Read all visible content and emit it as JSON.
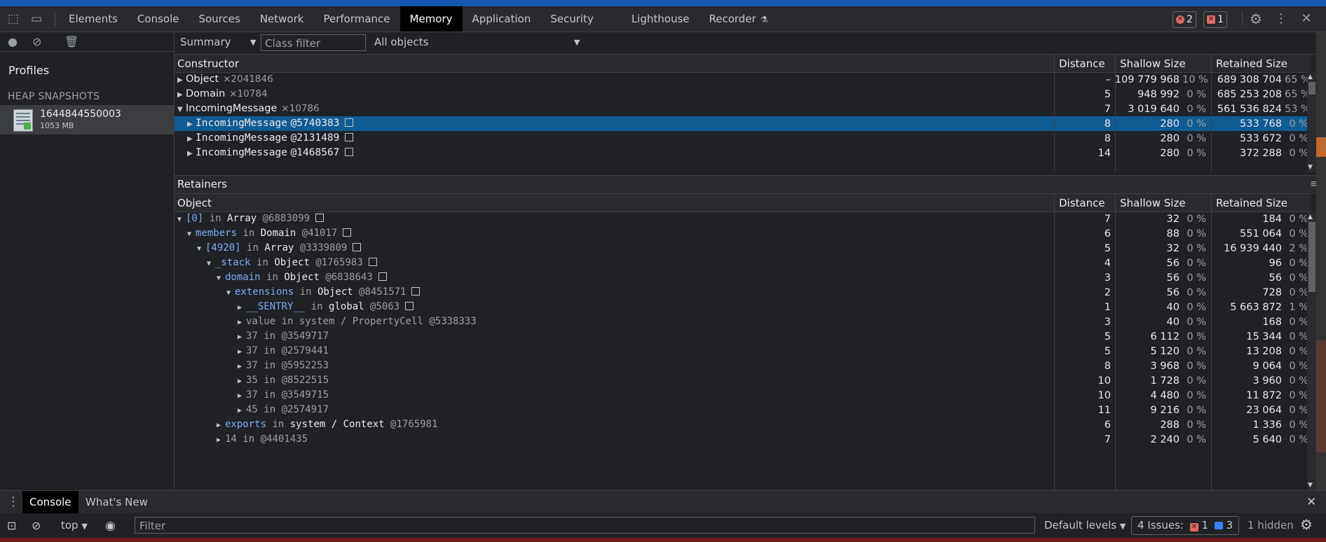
{
  "tabbar": {
    "tabs": [
      "Elements",
      "Console",
      "Sources",
      "Network",
      "Performance",
      "Memory",
      "Application",
      "Security",
      "Lighthouse",
      "Recorder"
    ],
    "active_tab": "Memory",
    "errors_count": "2",
    "warnings_count": "1"
  },
  "left": {
    "profiles_label": "Profiles",
    "heading": "HEAP SNAPSHOTS",
    "snapshot_name": "1644844550003",
    "snapshot_size": "1053 MB"
  },
  "toolbar": {
    "view_select": "Summary",
    "class_filter_placeholder": "Class filter",
    "objects_select": "All objects"
  },
  "constructors": {
    "columns": {
      "name": "Constructor",
      "distance": "Distance",
      "shallow": "Shallow Size",
      "retained": "Retained Size"
    },
    "rows": [
      {
        "tri": "▶",
        "name": "Object",
        "count": "×2041846",
        "distance": "–",
        "shallow": "109 779 968",
        "shallow_pct": "10 %",
        "retained": "689 308 704",
        "retained_pct": "65 %"
      },
      {
        "tri": "▶",
        "name": "Domain",
        "count": "×10784",
        "distance": "5",
        "shallow": "948 992",
        "shallow_pct": "0 %",
        "retained": "685 253 208",
        "retained_pct": "65 %"
      },
      {
        "tri": "▼",
        "name": "IncomingMessage",
        "count": "×10786",
        "distance": "7",
        "shallow": "3 019 640",
        "shallow_pct": "0 %",
        "retained": "561 536 824",
        "retained_pct": "53 %"
      },
      {
        "tri": "▶",
        "name": "IncomingMessage",
        "id": "@5740383",
        "distance": "8",
        "shallow": "280",
        "shallow_pct": "0 %",
        "retained": "533 768",
        "retained_pct": "0 %"
      },
      {
        "tri": "▶",
        "name": "IncomingMessage",
        "id": "@2131489",
        "distance": "8",
        "shallow": "280",
        "shallow_pct": "0 %",
        "retained": "533 672",
        "retained_pct": "0 %"
      },
      {
        "tri": "▶",
        "name": "IncomingMessage",
        "id": "@1468567",
        "distance": "14",
        "shallow": "280",
        "shallow_pct": "0 %",
        "retained": "372 288",
        "retained_pct": "0 %"
      }
    ]
  },
  "retainers": {
    "title": "Retainers",
    "columns": {
      "name": "Object",
      "distance": "Distance",
      "shallow": "Shallow Size",
      "retained": "Retained Size"
    },
    "rows": [
      {
        "tri": "▼",
        "prop": "[0]",
        "in": "in",
        "obj": "Array",
        "id": "@6883099",
        "distance": "7",
        "shallow": "32",
        "shallow_pct": "0 %",
        "retained": "184",
        "retained_pct": "0 %"
      },
      {
        "tri": "▼",
        "prop": "members",
        "in": "in",
        "obj": "Domain",
        "id": "@41017",
        "distance": "6",
        "shallow": "88",
        "shallow_pct": "0 %",
        "retained": "551 064",
        "retained_pct": "0 %"
      },
      {
        "tri": "▼",
        "prop": "[4920]",
        "in": "in",
        "obj": "Array",
        "id": "@3339809",
        "distance": "5",
        "shallow": "32",
        "shallow_pct": "0 %",
        "retained": "16 939 440",
        "retained_pct": "2 %"
      },
      {
        "tri": "▼",
        "prop": "_stack",
        "in": "in",
        "obj": "Object",
        "id": "@1765983",
        "distance": "4",
        "shallow": "56",
        "shallow_pct": "0 %",
        "retained": "96",
        "retained_pct": "0 %"
      },
      {
        "tri": "▼",
        "prop": "domain",
        "in": "in",
        "obj": "Object",
        "id": "@6838643",
        "distance": "3",
        "shallow": "56",
        "shallow_pct": "0 %",
        "retained": "56",
        "retained_pct": "0 %"
      },
      {
        "tri": "▼",
        "prop": "extensions",
        "in": "in",
        "obj": "Object",
        "id": "@8451571",
        "distance": "2",
        "shallow": "56",
        "shallow_pct": "0 %",
        "retained": "728",
        "retained_pct": "0 %"
      },
      {
        "tri": "▶",
        "prop": "__SENTRY__",
        "in": "in",
        "obj": "global",
        "id": "@5063",
        "distance": "1",
        "shallow": "40",
        "shallow_pct": "0 %",
        "retained": "5 663 872",
        "retained_pct": "1 %"
      },
      {
        "tri": "▶",
        "prop": "value",
        "in": "in",
        "obj": "system / PropertyCell",
        "id": "@5338333",
        "distance": "3",
        "shallow": "40",
        "shallow_pct": "0 %",
        "retained": "168",
        "retained_pct": "0 %"
      },
      {
        "tri": "▶",
        "prop": "37",
        "in": "in",
        "obj": "",
        "id": "@3549717",
        "distance": "5",
        "shallow": "6 112",
        "shallow_pct": "0 %",
        "retained": "15 344",
        "retained_pct": "0 %"
      },
      {
        "tri": "▶",
        "prop": "37",
        "in": "in",
        "obj": "",
        "id": "@2579441",
        "distance": "5",
        "shallow": "5 120",
        "shallow_pct": "0 %",
        "retained": "13 208",
        "retained_pct": "0 %"
      },
      {
        "tri": "▶",
        "prop": "37",
        "in": "in",
        "obj": "",
        "id": "@5952253",
        "distance": "8",
        "shallow": "3 968",
        "shallow_pct": "0 %",
        "retained": "9 064",
        "retained_pct": "0 %"
      },
      {
        "tri": "▶",
        "prop": "35",
        "in": "in",
        "obj": "",
        "id": "@8522515",
        "distance": "10",
        "shallow": "1 728",
        "shallow_pct": "0 %",
        "retained": "3 960",
        "retained_pct": "0 %"
      },
      {
        "tri": "▶",
        "prop": "37",
        "in": "in",
        "obj": "",
        "id": "@3549715",
        "distance": "10",
        "shallow": "4 480",
        "shallow_pct": "0 %",
        "retained": "11 872",
        "retained_pct": "0 %"
      },
      {
        "tri": "▶",
        "prop": "45",
        "in": "in",
        "obj": "",
        "id": "@2574917",
        "distance": "11",
        "shallow": "9 216",
        "shallow_pct": "0 %",
        "retained": "23 064",
        "retained_pct": "0 %"
      },
      {
        "tri": "▶",
        "prop": "exports",
        "in": "in",
        "obj": "system / Context",
        "id": "@1765981",
        "distance": "6",
        "shallow": "288",
        "shallow_pct": "0 %",
        "retained": "1 336",
        "retained_pct": "0 %"
      },
      {
        "tri": "▶",
        "prop": "14",
        "in": "in",
        "obj": "",
        "id": "@4401435",
        "distance": "7",
        "shallow": "2 240",
        "shallow_pct": "0 %",
        "retained": "5 640",
        "retained_pct": "0 %"
      }
    ]
  },
  "drawer": {
    "tabs": [
      "Console",
      "What's New"
    ],
    "context": "top",
    "filter_placeholder": "Filter",
    "levels": "Default levels",
    "issues_label": "4 Issues:",
    "issues_errors": "1",
    "issues_info": "3",
    "hidden": "1 hidden"
  }
}
